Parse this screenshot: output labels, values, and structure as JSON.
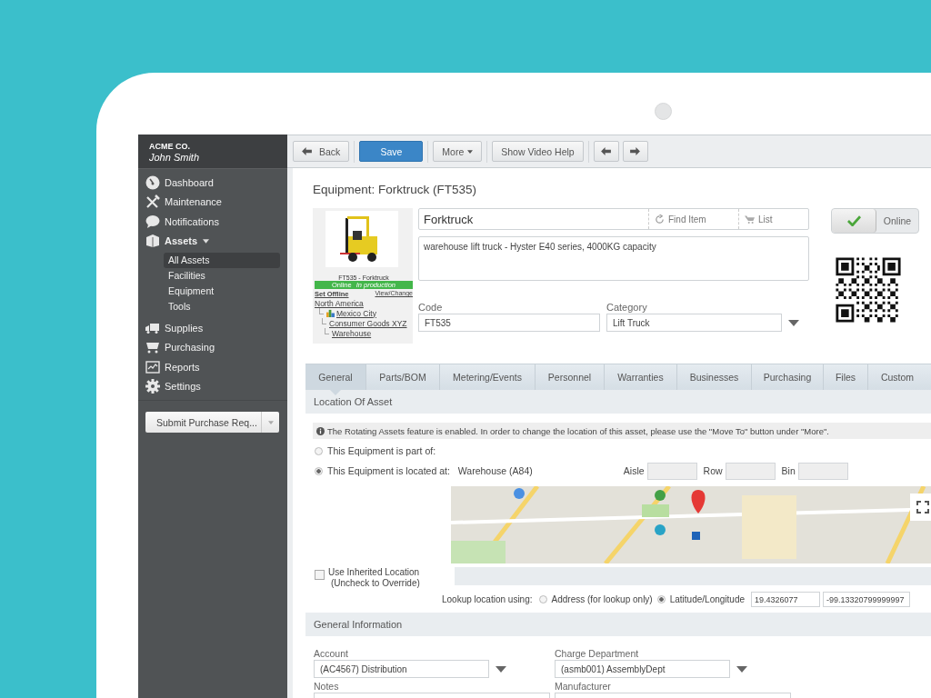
{
  "company": "ACME CO.",
  "user": "John Smith",
  "nav": [
    {
      "label": "Dashboard",
      "kind": "dashboard"
    },
    {
      "label": "Maintenance",
      "kind": "tools"
    },
    {
      "label": "Notifications",
      "kind": "bubble"
    },
    {
      "label": "Assets",
      "kind": "box",
      "expanded": true,
      "children": [
        {
          "label": "All Assets",
          "selected": true
        },
        {
          "label": "Facilities",
          "selected": false
        },
        {
          "label": "Equipment",
          "selected": false
        },
        {
          "label": "Tools",
          "selected": false
        }
      ]
    },
    {
      "label": "Supplies",
      "kind": "truck"
    },
    {
      "label": "Purchasing",
      "kind": "cart"
    },
    {
      "label": "Reports",
      "kind": "chart"
    },
    {
      "label": "Settings",
      "kind": "gear"
    }
  ],
  "submit_button": "Submit Purchase Req...",
  "toolbar": {
    "back": "Back",
    "save": "Save",
    "more": "More",
    "video_help": "Show Video Help"
  },
  "title": "Equipment: Forktruck (FT535)",
  "asset_card": {
    "caption": "FT535 - Forktruck",
    "status": "Online",
    "status_note": "In production",
    "set_offline": "Set Offline",
    "view_change": "View/Change",
    "location_tree": [
      {
        "label": "North America",
        "children": [
          {
            "label": "Mexico City",
            "children": [
              {
                "label": "Consumer Goods XYZ",
                "children": [
                  {
                    "label": "Warehouse"
                  }
                ]
              }
            ]
          }
        ]
      }
    ]
  },
  "name_field": "Forktruck",
  "find_item": "Find Item",
  "list": "List",
  "description": "warehouse lift truck - Hyster E40 series, 4000KG capacity",
  "online_toggle": {
    "label": "Online",
    "on": true
  },
  "code": {
    "label": "Code",
    "value": "FT535"
  },
  "category": {
    "label": "Category",
    "value": "Lift Truck"
  },
  "tabs": [
    {
      "label": "General",
      "selected": true
    },
    {
      "label": "Parts/BOM",
      "selected": false
    },
    {
      "label": "Metering/Events",
      "selected": false
    },
    {
      "label": "Personnel",
      "selected": false
    },
    {
      "label": "Warranties",
      "selected": false
    },
    {
      "label": "Businesses",
      "selected": false
    },
    {
      "label": "Purchasing",
      "selected": false
    },
    {
      "label": "Files",
      "selected": false
    },
    {
      "label": "Custom",
      "selected": false
    }
  ],
  "location_section": "Location Of Asset",
  "info": "The Rotating Assets feature is enabled. In order to change the location of this asset, please use the \"Move To\" button under \"More\".",
  "location_options": [
    {
      "label": "This Equipment is part of:",
      "selected": false
    },
    {
      "label": "This Equipment is located at:",
      "selected": true
    }
  ],
  "located_value": "Warehouse (A84)",
  "slots": [
    {
      "label": "Aisle"
    },
    {
      "label": "Row"
    },
    {
      "label": "Bin"
    }
  ],
  "inherited": {
    "label": "Use Inherited Location",
    "hint": "(Uncheck to Override)",
    "checked": false
  },
  "lookup": {
    "label": "Lookup location using:",
    "options": [
      {
        "label": "Address (for lookup only)",
        "selected": false
      },
      {
        "label": "Latitude/Longitude",
        "selected": true
      }
    ],
    "latitude": "19.4326077",
    "longitude": "-99.13320799999997"
  },
  "general_section": "General Information",
  "fields": [
    {
      "label": "Account",
      "value": "(AC4567) Distribution",
      "kind": "select"
    },
    {
      "label": "Charge Department",
      "value": "(asmb001) AssemblyDept",
      "kind": "select"
    },
    {
      "label": "Notes",
      "kind": "text"
    },
    {
      "label": "Manufacturer",
      "kind": "text"
    }
  ]
}
